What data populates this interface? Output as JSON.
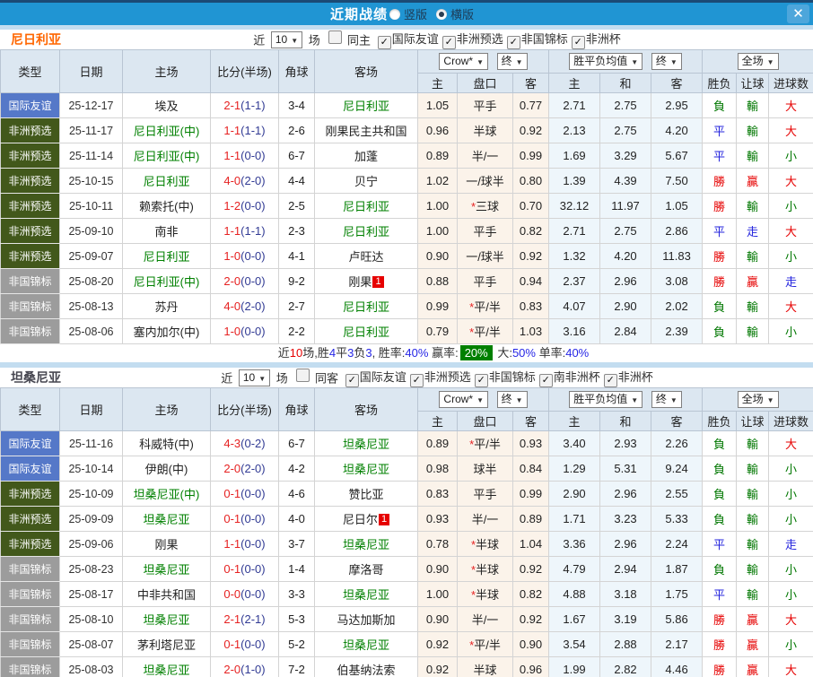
{
  "titlebar": {
    "title": "近期战绩",
    "orientation_options": [
      {
        "label": "竖版",
        "selected": false
      },
      {
        "label": "横版",
        "selected": true
      }
    ],
    "close_icon": "✕"
  },
  "filter_labels": {
    "near": "近",
    "count": "10",
    "games": "场"
  },
  "table_header": {
    "col_type": "类型",
    "col_date": "日期",
    "col_home": "主场",
    "col_score": "比分(半场)",
    "col_corner": "角球",
    "col_away": "客场",
    "odds_company_dropdown": "Crow*",
    "odds_final_dropdown": "终",
    "avg_dropdown": "胜平负均值",
    "avg_final_dropdown": "终",
    "scope_dropdown": "全场",
    "sub_home": "主",
    "sub_handicap": "盘口",
    "sub_away": "客",
    "sub_avg_home": "主",
    "sub_avg_draw": "和",
    "sub_avg_away": "客",
    "sub_result": "胜负",
    "sub_handicap_result": "让球",
    "sub_goals": "进球数"
  },
  "sections": [
    {
      "team": "尼日利亚",
      "team_color": "#ff6600",
      "same_filter": "同主",
      "same_checked": false,
      "competitions": [
        {
          "label": "国际友谊",
          "checked": true
        },
        {
          "label": "非洲预选",
          "checked": true
        },
        {
          "label": "非国锦标",
          "checked": true
        },
        {
          "label": "非洲杯",
          "checked": true
        }
      ],
      "rows": [
        {
          "type": "国际友谊",
          "date": "25-12-17",
          "home": "埃及",
          "home_active": false,
          "score": "2-1",
          "half": "(1-1)",
          "corner": "3-4",
          "away": "尼日利亚",
          "away_active": true,
          "away_badge": "",
          "odds_home": "1.05",
          "handicap": "平手",
          "odds_away": "0.77",
          "avg_home": "2.71",
          "avg_draw": "2.75",
          "avg_away": "2.95",
          "result": "負",
          "handicap_result": "輸",
          "goals_result": "大"
        },
        {
          "type": "非洲预选",
          "date": "25-11-17",
          "home": "尼日利亚(中)",
          "home_active": true,
          "score": "1-1",
          "half": "(1-1)",
          "corner": "2-6",
          "away": "刚果民主共和国",
          "away_active": false,
          "away_badge": "",
          "odds_home": "0.96",
          "handicap": "半球",
          "odds_away": "0.92",
          "avg_home": "2.13",
          "avg_draw": "2.75",
          "avg_away": "4.20",
          "result": "平",
          "handicap_result": "輸",
          "goals_result": "大"
        },
        {
          "type": "非洲预选",
          "date": "25-11-14",
          "home": "尼日利亚(中)",
          "home_active": true,
          "score": "1-1",
          "half": "(0-0)",
          "corner": "6-7",
          "away": "加蓬",
          "away_active": false,
          "away_badge": "",
          "odds_home": "0.89",
          "handicap": "半/一",
          "odds_away": "0.99",
          "avg_home": "1.69",
          "avg_draw": "3.29",
          "avg_away": "5.67",
          "result": "平",
          "handicap_result": "輸",
          "goals_result": "小"
        },
        {
          "type": "非洲预选",
          "date": "25-10-15",
          "home": "尼日利亚",
          "home_active": true,
          "score": "4-0",
          "half": "(2-0)",
          "corner": "4-4",
          "away": "贝宁",
          "away_active": false,
          "away_badge": "",
          "odds_home": "1.02",
          "handicap": "一/球半",
          "odds_away": "0.80",
          "avg_home": "1.39",
          "avg_draw": "4.39",
          "avg_away": "7.50",
          "result": "勝",
          "handicap_result": "贏",
          "goals_result": "大"
        },
        {
          "type": "非洲预选",
          "date": "25-10-11",
          "home": "赖索托(中)",
          "home_active": false,
          "score": "1-2",
          "half": "(0-0)",
          "corner": "2-5",
          "away": "尼日利亚",
          "away_active": true,
          "away_badge": "",
          "odds_home": "1.00",
          "handicap": "*三球",
          "odds_away": "0.70",
          "avg_home": "32.12",
          "avg_draw": "11.97",
          "avg_away": "1.05",
          "result": "勝",
          "handicap_result": "輸",
          "goals_result": "小"
        },
        {
          "type": "非洲预选",
          "date": "25-09-10",
          "home": "南非",
          "home_active": false,
          "score": "1-1",
          "half": "(1-1)",
          "corner": "2-3",
          "away": "尼日利亚",
          "away_active": true,
          "away_badge": "",
          "odds_home": "1.00",
          "handicap": "平手",
          "odds_away": "0.82",
          "avg_home": "2.71",
          "avg_draw": "2.75",
          "avg_away": "2.86",
          "result": "平",
          "handicap_result": "走",
          "goals_result": "大"
        },
        {
          "type": "非洲预选",
          "date": "25-09-07",
          "home": "尼日利亚",
          "home_active": true,
          "score": "1-0",
          "half": "(0-0)",
          "corner": "4-1",
          "away": "卢旺达",
          "away_active": false,
          "away_badge": "",
          "odds_home": "0.90",
          "handicap": "一/球半",
          "odds_away": "0.92",
          "avg_home": "1.32",
          "avg_draw": "4.20",
          "avg_away": "11.83",
          "result": "勝",
          "handicap_result": "輸",
          "goals_result": "小"
        },
        {
          "type": "非国锦标",
          "date": "25-08-20",
          "home": "尼日利亚(中)",
          "home_active": true,
          "score": "2-0",
          "half": "(0-0)",
          "corner": "9-2",
          "away": "刚果",
          "away_active": false,
          "away_badge": "1",
          "odds_home": "0.88",
          "handicap": "平手",
          "odds_away": "0.94",
          "avg_home": "2.37",
          "avg_draw": "2.96",
          "avg_away": "3.08",
          "result": "勝",
          "handicap_result": "贏",
          "goals_result": "走"
        },
        {
          "type": "非国锦标",
          "date": "25-08-13",
          "home": "苏丹",
          "home_active": false,
          "score": "4-0",
          "half": "(2-0)",
          "corner": "2-7",
          "away": "尼日利亚",
          "away_active": true,
          "away_badge": "",
          "odds_home": "0.99",
          "handicap": "*平/半",
          "odds_away": "0.83",
          "avg_home": "4.07",
          "avg_draw": "2.90",
          "avg_away": "2.02",
          "result": "負",
          "handicap_result": "輸",
          "goals_result": "大"
        },
        {
          "type": "非国锦标",
          "date": "25-08-06",
          "home": "塞内加尔(中)",
          "home_active": false,
          "score": "1-0",
          "half": "(0-0)",
          "corner": "2-2",
          "away": "尼日利亚",
          "away_active": true,
          "away_badge": "",
          "odds_home": "0.79",
          "handicap": "*平/半",
          "odds_away": "1.03",
          "avg_home": "3.16",
          "avg_draw": "2.84",
          "avg_away": "2.39",
          "result": "負",
          "handicap_result": "輸",
          "goals_result": "小"
        }
      ],
      "summary": [
        {
          "text": "近",
          "style": "dark"
        },
        {
          "text": "10",
          "style": "red"
        },
        {
          "text": "场,胜",
          "style": "dark"
        },
        {
          "text": "4",
          "style": "blue"
        },
        {
          "text": "平",
          "style": "dark"
        },
        {
          "text": "3",
          "style": "blue"
        },
        {
          "text": "负",
          "style": "dark"
        },
        {
          "text": "3",
          "style": "blue"
        },
        {
          "text": ", 胜率:",
          "style": "dark"
        },
        {
          "text": "40%",
          "style": "blue"
        },
        {
          "text": " 赢率:",
          "style": "dark"
        },
        {
          "text": "20%",
          "style": "greenbox"
        },
        {
          "text": " 大:",
          "style": "dark"
        },
        {
          "text": "50%",
          "style": "blue"
        },
        {
          "text": " 单率:",
          "style": "dark"
        },
        {
          "text": "40%",
          "style": "blue"
        }
      ]
    },
    {
      "team": "坦桑尼亚",
      "team_color": "#474751",
      "same_filter": "同客",
      "same_checked": false,
      "competitions": [
        {
          "label": "国际友谊",
          "checked": true
        },
        {
          "label": "非洲预选",
          "checked": true
        },
        {
          "label": "非国锦标",
          "checked": true
        },
        {
          "label": "南非洲杯",
          "checked": true
        },
        {
          "label": "非洲杯",
          "checked": true
        }
      ],
      "rows": [
        {
          "type": "国际友谊",
          "date": "25-11-16",
          "home": "科威特(中)",
          "home_active": false,
          "score": "4-3",
          "half": "(0-2)",
          "corner": "6-7",
          "away": "坦桑尼亚",
          "away_active": true,
          "away_badge": "",
          "odds_home": "0.89",
          "handicap": "*平/半",
          "odds_away": "0.93",
          "avg_home": "3.40",
          "avg_draw": "2.93",
          "avg_away": "2.26",
          "result": "負",
          "handicap_result": "輸",
          "goals_result": "大"
        },
        {
          "type": "国际友谊",
          "date": "25-10-14",
          "home": "伊朗(中)",
          "home_active": false,
          "score": "2-0",
          "half": "(2-0)",
          "corner": "4-2",
          "away": "坦桑尼亚",
          "away_active": true,
          "away_badge": "",
          "odds_home": "0.98",
          "handicap": "球半",
          "odds_away": "0.84",
          "avg_home": "1.29",
          "avg_draw": "5.31",
          "avg_away": "9.24",
          "result": "負",
          "handicap_result": "輸",
          "goals_result": "小"
        },
        {
          "type": "非洲预选",
          "date": "25-10-09",
          "home": "坦桑尼亚(中)",
          "home_active": true,
          "score": "0-1",
          "half": "(0-0)",
          "corner": "4-6",
          "away": "赞比亚",
          "away_active": false,
          "away_badge": "",
          "odds_home": "0.83",
          "handicap": "平手",
          "odds_away": "0.99",
          "avg_home": "2.90",
          "avg_draw": "2.96",
          "avg_away": "2.55",
          "result": "負",
          "handicap_result": "輸",
          "goals_result": "小"
        },
        {
          "type": "非洲预选",
          "date": "25-09-09",
          "home": "坦桑尼亚",
          "home_active": true,
          "score": "0-1",
          "half": "(0-0)",
          "corner": "4-0",
          "away": "尼日尔",
          "away_active": false,
          "away_badge": "1",
          "odds_home": "0.93",
          "handicap": "半/一",
          "odds_away": "0.89",
          "avg_home": "1.71",
          "avg_draw": "3.23",
          "avg_away": "5.33",
          "result": "負",
          "handicap_result": "輸",
          "goals_result": "小"
        },
        {
          "type": "非洲预选",
          "date": "25-09-06",
          "home": "刚果",
          "home_active": false,
          "score": "1-1",
          "half": "(0-0)",
          "corner": "3-7",
          "away": "坦桑尼亚",
          "away_active": true,
          "away_badge": "",
          "odds_home": "0.78",
          "handicap": "*半球",
          "odds_away": "1.04",
          "avg_home": "3.36",
          "avg_draw": "2.96",
          "avg_away": "2.24",
          "result": "平",
          "handicap_result": "輸",
          "goals_result": "走"
        },
        {
          "type": "非国锦标",
          "date": "25-08-23",
          "home": "坦桑尼亚",
          "home_active": true,
          "score": "0-1",
          "half": "(0-0)",
          "corner": "1-4",
          "away": "摩洛哥",
          "away_active": false,
          "away_badge": "",
          "odds_home": "0.90",
          "handicap": "*半球",
          "odds_away": "0.92",
          "avg_home": "4.79",
          "avg_draw": "2.94",
          "avg_away": "1.87",
          "result": "負",
          "handicap_result": "輸",
          "goals_result": "小"
        },
        {
          "type": "非国锦标",
          "date": "25-08-17",
          "home": "中非共和国",
          "home_active": false,
          "score": "0-0",
          "half": "(0-0)",
          "corner": "3-3",
          "away": "坦桑尼亚",
          "away_active": true,
          "away_badge": "",
          "odds_home": "1.00",
          "handicap": "*半球",
          "odds_away": "0.82",
          "avg_home": "4.88",
          "avg_draw": "3.18",
          "avg_away": "1.75",
          "result": "平",
          "handicap_result": "輸",
          "goals_result": "小"
        },
        {
          "type": "非国锦标",
          "date": "25-08-10",
          "home": "坦桑尼亚",
          "home_active": true,
          "score": "2-1",
          "half": "(2-1)",
          "corner": "5-3",
          "away": "马达加斯加",
          "away_active": false,
          "away_badge": "",
          "odds_home": "0.90",
          "handicap": "半/一",
          "odds_away": "0.92",
          "avg_home": "1.67",
          "avg_draw": "3.19",
          "avg_away": "5.86",
          "result": "勝",
          "handicap_result": "贏",
          "goals_result": "大"
        },
        {
          "type": "非国锦标",
          "date": "25-08-07",
          "home": "茅利塔尼亚",
          "home_active": false,
          "score": "0-1",
          "half": "(0-0)",
          "corner": "5-2",
          "away": "坦桑尼亚",
          "away_active": true,
          "away_badge": "",
          "odds_home": "0.92",
          "handicap": "*平/半",
          "odds_away": "0.90",
          "avg_home": "3.54",
          "avg_draw": "2.88",
          "avg_away": "2.17",
          "result": "勝",
          "handicap_result": "贏",
          "goals_result": "小"
        },
        {
          "type": "非国锦标",
          "date": "25-08-03",
          "home": "坦桑尼亚",
          "home_active": true,
          "score": "2-0",
          "half": "(1-0)",
          "corner": "7-2",
          "away": "伯基纳法索",
          "away_active": false,
          "away_badge": "",
          "odds_home": "0.92",
          "handicap": "半球",
          "odds_away": "0.96",
          "avg_home": "1.99",
          "avg_draw": "2.82",
          "avg_away": "4.46",
          "result": "勝",
          "handicap_result": "贏",
          "goals_result": "大"
        }
      ],
      "summary": null
    }
  ],
  "colors": {
    "titlebar_bg": "#2095d3",
    "top_strip": "#1b4a75",
    "type_colors": {
      "国际友谊": "#5578c8",
      "非洲预选": "#42581b",
      "非国锦标": "#9c9c9c"
    },
    "result_char_colors": {
      "勝": "#e60000",
      "贏": "#e60000",
      "大": "#e60000",
      "平": "#2323dd",
      "走": "#2323dd",
      "負": "#007700",
      "輸": "#007700",
      "小": "#007700"
    },
    "active_team": "#008000",
    "score_full": "#e62222",
    "score_half": "#323b94"
  }
}
